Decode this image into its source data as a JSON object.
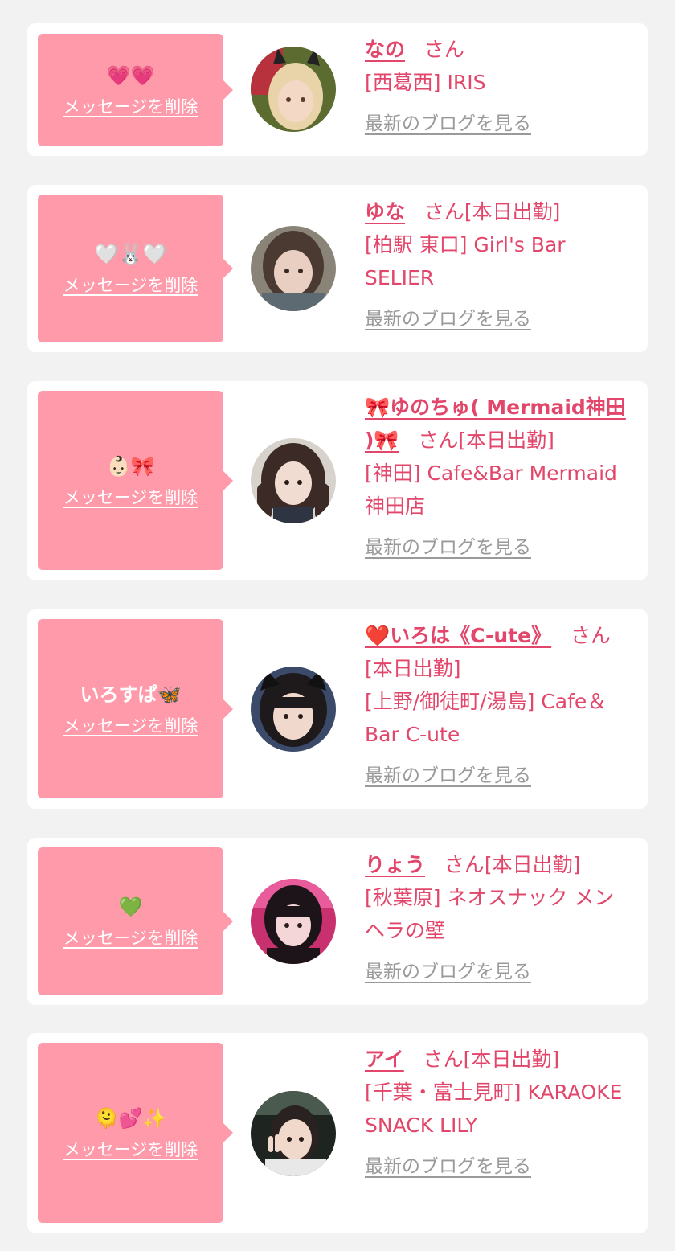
{
  "entries": [
    {
      "message": "💗💗",
      "delete_label": "メッセージを削除",
      "name": "なの",
      "suffix": "さん",
      "location_shop": "[西葛西] IRIS",
      "blog_label": "最新のブログを見る",
      "avatar_icon": "girl-photo-blonde"
    },
    {
      "message": "🤍🐰🤍",
      "delete_label": "メッセージを削除",
      "name": "ゆな",
      "suffix": "さん[本日出勤]",
      "location_shop": "[柏駅 東口] Girl's Bar SELIER",
      "blog_label": "最新のブログを見る",
      "avatar_icon": "girl-photo-gray"
    },
    {
      "message": "👶🏻🎀",
      "delete_label": "メッセージを削除",
      "name": "🎀ゆのちゅ( Mermaid神田 )🎀",
      "suffix": "さん[本日出勤]",
      "location_shop": "[神田] Cafe&Bar Mermaid 神田店",
      "blog_label": "最新のブログを見る",
      "avatar_icon": "girl-photo-twintails"
    },
    {
      "message": "いろすぱ🦋",
      "delete_label": "メッセージを削除",
      "name": "❤️いろは《C-ute》",
      "suffix": "さん[本日出勤]",
      "location_shop": "[上野/御徒町/湯島] Cafe＆Bar C-ute",
      "blog_label": "最新のブログを見る",
      "avatar_icon": "girl-photo-catears"
    },
    {
      "message": "💚",
      "delete_label": "メッセージを削除",
      "name": "りょう",
      "suffix": "さん[本日出勤]",
      "location_shop": "[秋葉原] ネオスナック メンヘラの壁",
      "blog_label": "最新のブログを見る",
      "avatar_icon": "girl-photo-pink"
    },
    {
      "message": "🫠💕✨",
      "delete_label": "メッセージを削除",
      "name": "アイ",
      "suffix": "さん[本日出勤]",
      "location_shop": "[千葉・富士見町] KARAOKE SNACK LILY",
      "blog_label": "最新のブログを見る",
      "avatar_icon": "girl-photo-peace"
    }
  ],
  "colors": {
    "page_bg": "#f2f2f2",
    "card_bg": "#ffffff",
    "bubble_bg": "#fe9aaa",
    "accent_text": "#e2466a",
    "link_gray": "#9a9a9a"
  }
}
